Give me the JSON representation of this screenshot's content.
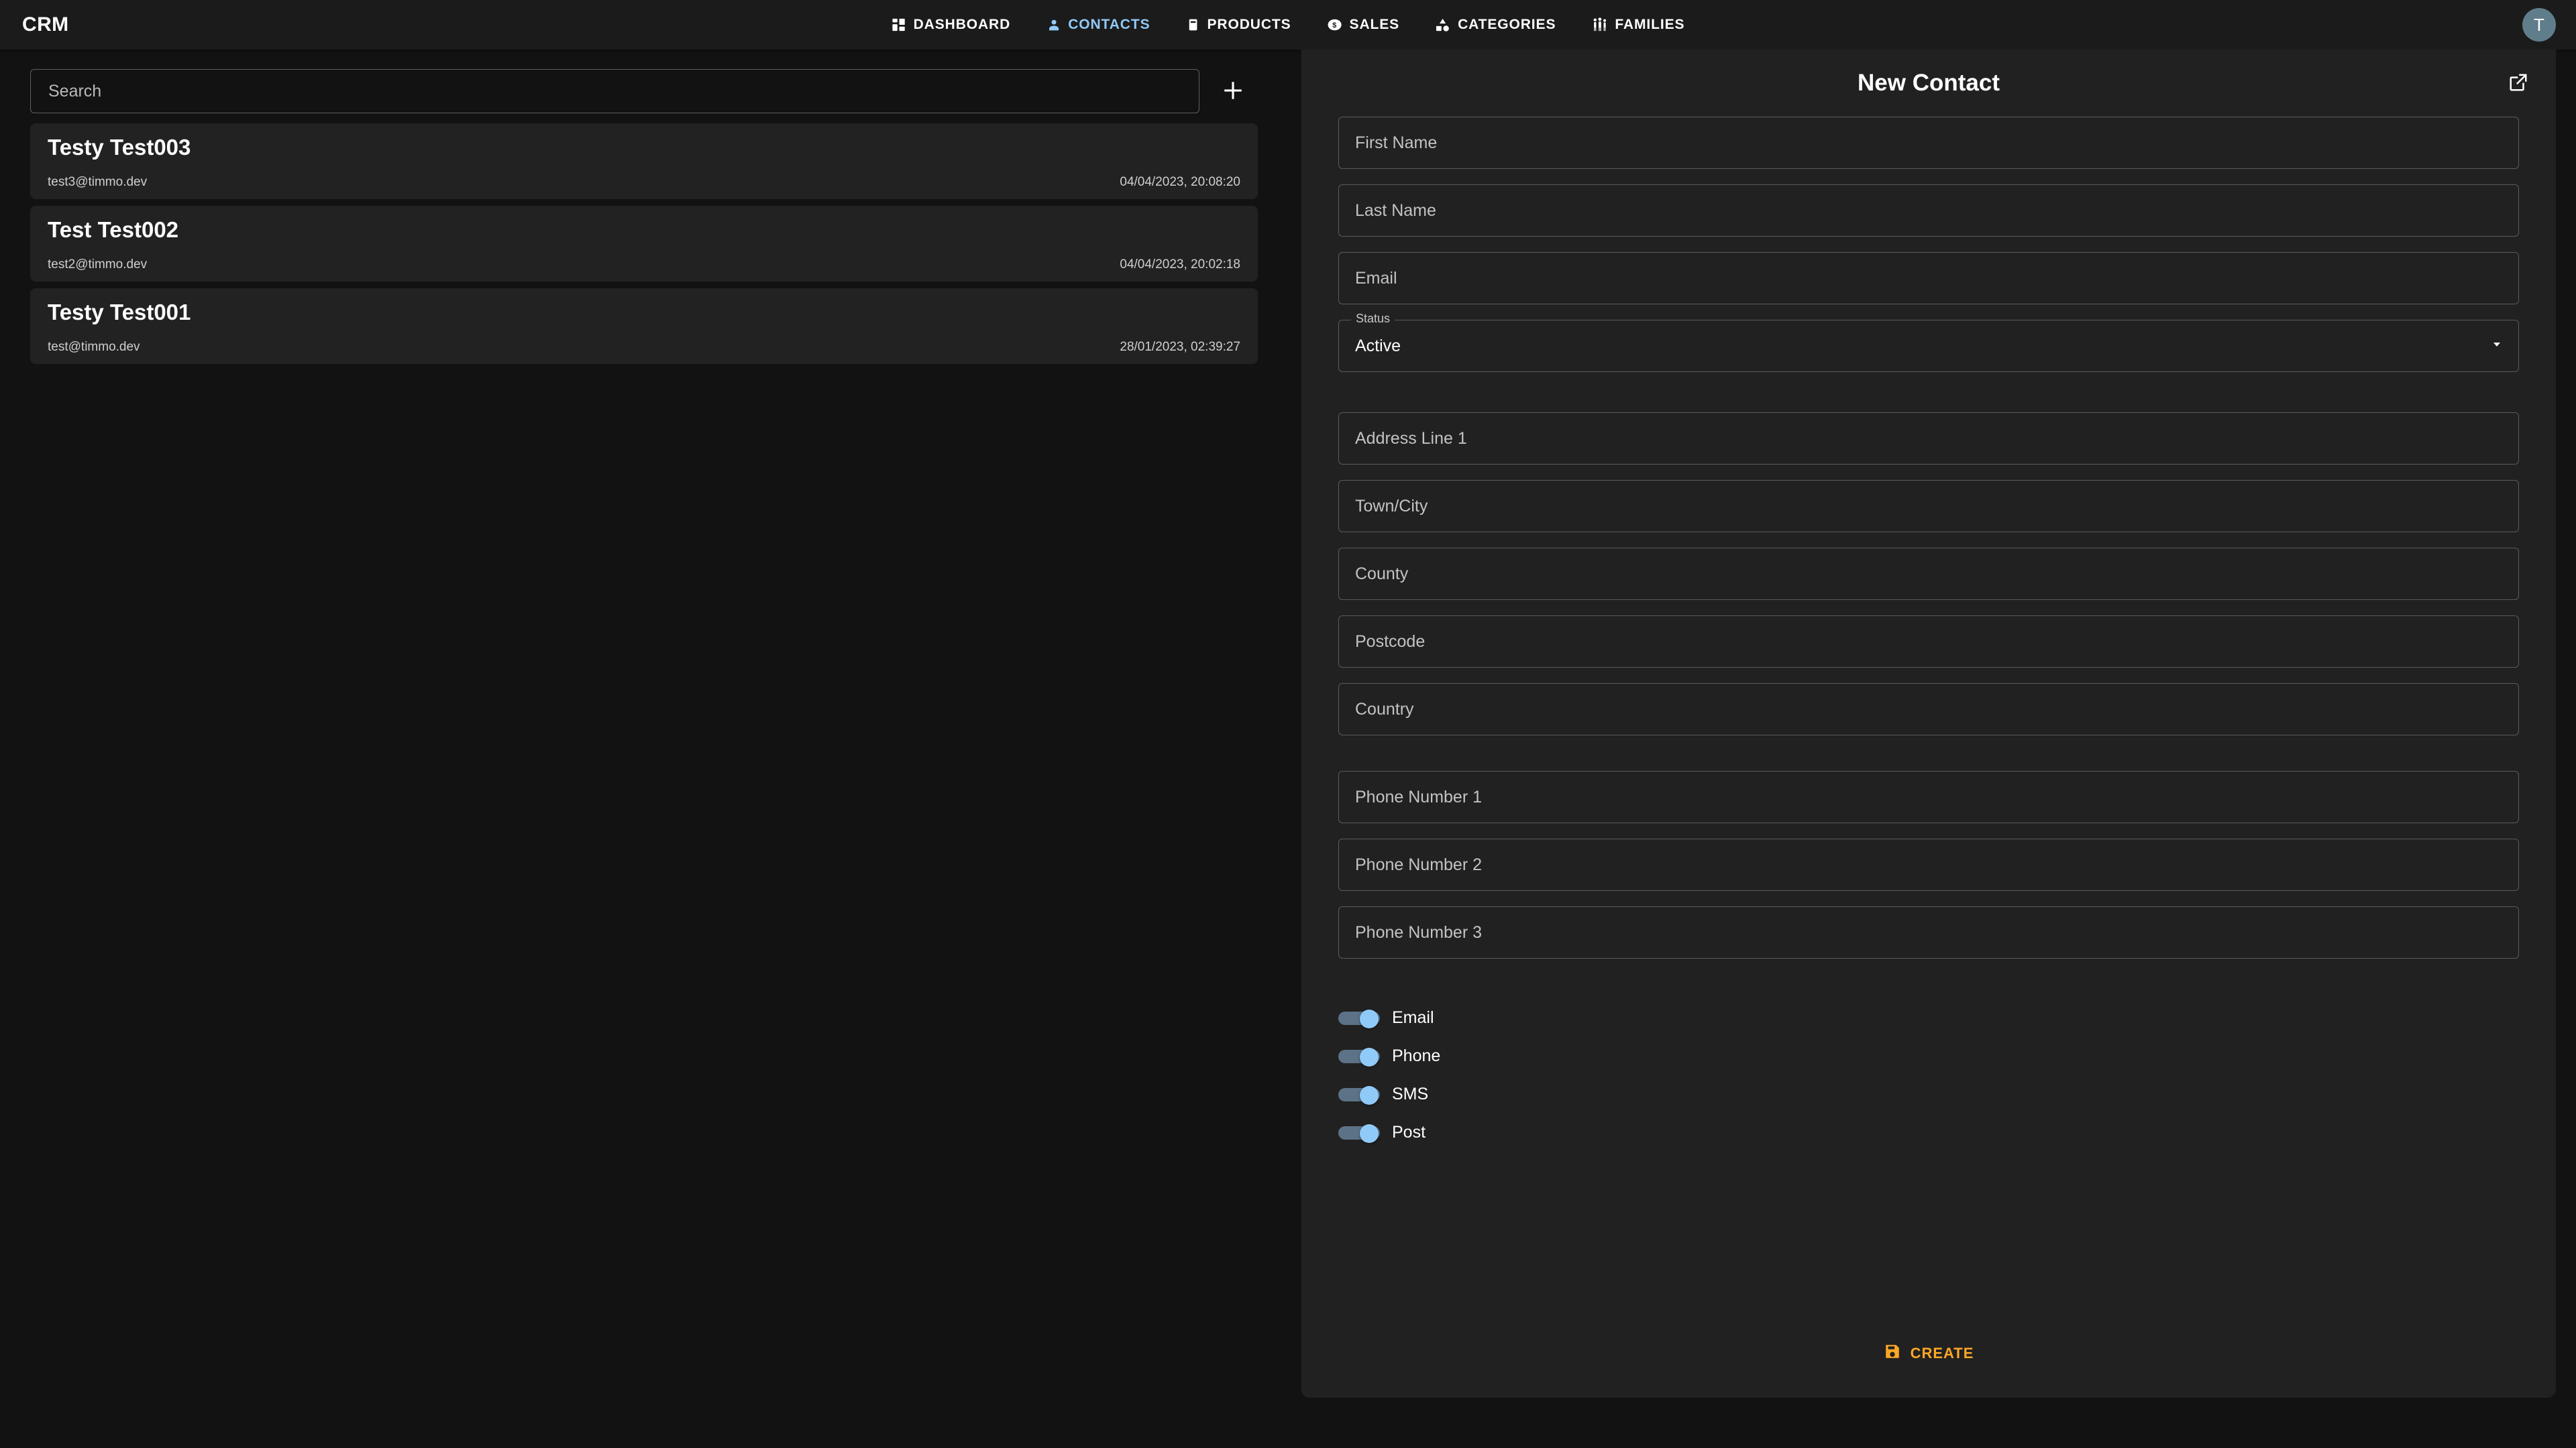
{
  "app": {
    "brand": "CRM",
    "avatar_initial": "T",
    "accent_blue": "#90caf9",
    "accent_orange": "#ffa726",
    "page_bg": "#121212",
    "panel_bg": "#212121",
    "appbar_bg": "#1b1b1b",
    "card_bg": "#222222"
  },
  "nav": {
    "items": [
      {
        "label": "DASHBOARD",
        "icon": "dashboard-grid-icon",
        "active": false
      },
      {
        "label": "CONTACTS",
        "icon": "person-icon",
        "active": true
      },
      {
        "label": "PRODUCTS",
        "icon": "product-box-icon",
        "active": false
      },
      {
        "label": "SALES",
        "icon": "dollar-coin-icon",
        "active": false
      },
      {
        "label": "CATEGORIES",
        "icon": "shapes-icon",
        "active": false
      },
      {
        "label": "FAMILIES",
        "icon": "family-people-icon",
        "active": false
      }
    ]
  },
  "search": {
    "placeholder": "Search",
    "value": "",
    "add_icon": "plus-icon"
  },
  "contacts": [
    {
      "name": "Testy Test003",
      "email": "test3@timmo.dev",
      "date": "04/04/2023, 20:08:20"
    },
    {
      "name": "Test Test002",
      "email": "test2@timmo.dev",
      "date": "04/04/2023, 20:02:18"
    },
    {
      "name": "Testy Test001",
      "email": "test@timmo.dev",
      "date": "28/01/2023, 02:39:27"
    }
  ],
  "panel": {
    "title": "New Contact",
    "open_in_new_icon": "open-in-new-icon",
    "fields": {
      "first_name": {
        "placeholder": "First Name",
        "value": ""
      },
      "last_name": {
        "placeholder": "Last Name",
        "value": ""
      },
      "email": {
        "placeholder": "Email",
        "value": ""
      },
      "address1": {
        "placeholder": "Address Line 1",
        "value": ""
      },
      "town_city": {
        "placeholder": "Town/City",
        "value": ""
      },
      "county": {
        "placeholder": "County",
        "value": ""
      },
      "postcode": {
        "placeholder": "Postcode",
        "value": ""
      },
      "country": {
        "placeholder": "Country",
        "value": ""
      },
      "phone1": {
        "placeholder": "Phone Number 1",
        "value": ""
      },
      "phone2": {
        "placeholder": "Phone Number 2",
        "value": ""
      },
      "phone3": {
        "placeholder": "Phone Number 3",
        "value": ""
      }
    },
    "status": {
      "label": "Status",
      "value": "Active",
      "arrow_icon": "chevron-down-icon"
    },
    "toggles": [
      {
        "label": "Email",
        "on": true
      },
      {
        "label": "Phone",
        "on": true
      },
      {
        "label": "SMS",
        "on": true
      },
      {
        "label": "Post",
        "on": true
      }
    ],
    "create_button": {
      "label": "CREATE",
      "icon": "save-floppy-icon"
    }
  }
}
